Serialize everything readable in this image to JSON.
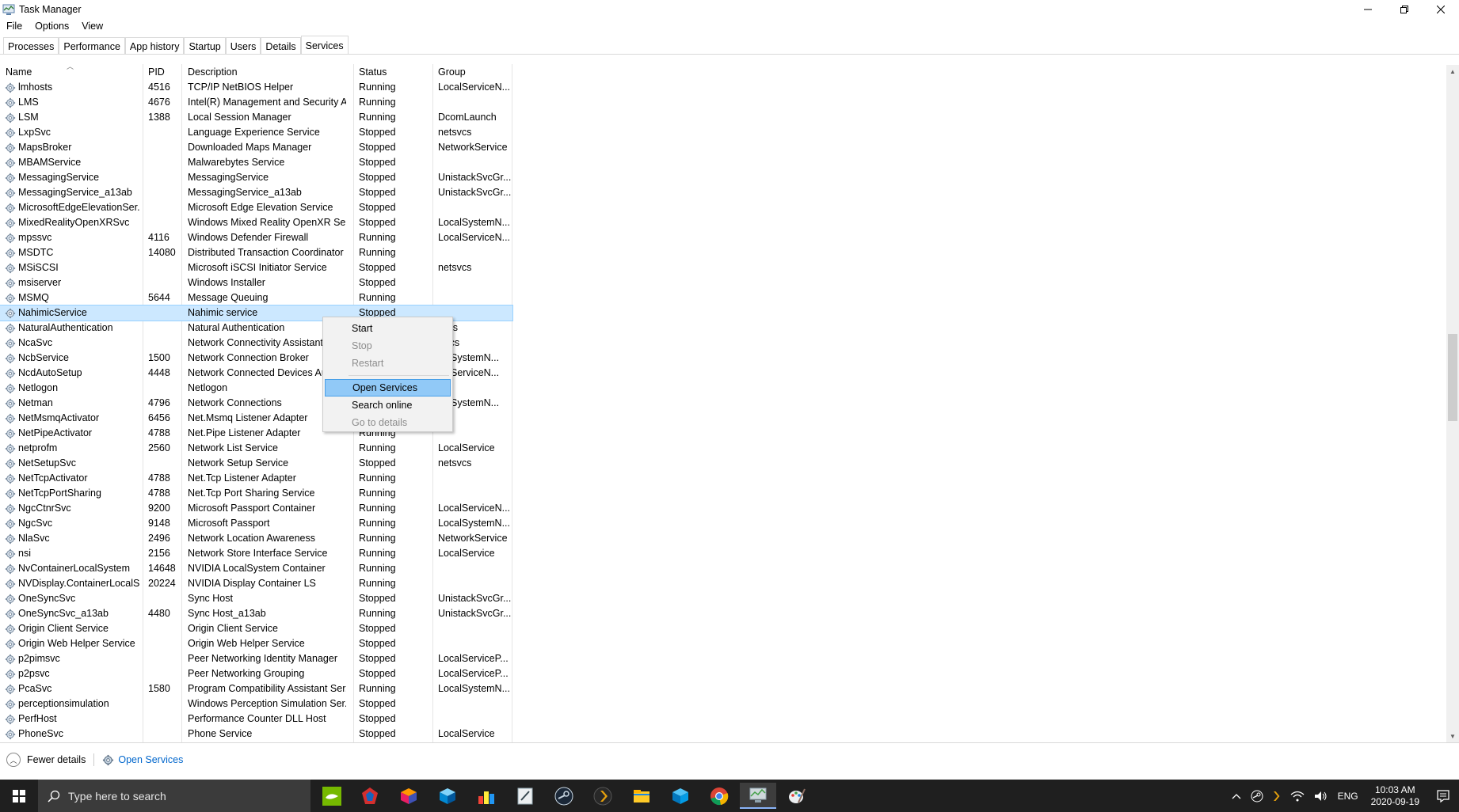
{
  "window": {
    "title": "Task Manager",
    "controls": {
      "minimize": "—",
      "restore": "❐",
      "close": "✕"
    }
  },
  "menu": [
    "File",
    "Options",
    "View"
  ],
  "tabs": [
    {
      "label": "Processes",
      "active": false
    },
    {
      "label": "Performance",
      "active": false
    },
    {
      "label": "App history",
      "active": false
    },
    {
      "label": "Startup",
      "active": false
    },
    {
      "label": "Users",
      "active": false
    },
    {
      "label": "Details",
      "active": false
    },
    {
      "label": "Services",
      "active": true
    }
  ],
  "columns": {
    "name": "Name",
    "pid": "PID",
    "description": "Description",
    "status": "Status",
    "group": "Group"
  },
  "rows": [
    {
      "name": "lmhosts",
      "pid": "4516",
      "desc": "TCP/IP NetBIOS Helper",
      "status": "Running",
      "group": "LocalServiceN..."
    },
    {
      "name": "LMS",
      "pid": "4676",
      "desc": "Intel(R) Management and Security A...",
      "status": "Running",
      "group": ""
    },
    {
      "name": "LSM",
      "pid": "1388",
      "desc": "Local Session Manager",
      "status": "Running",
      "group": "DcomLaunch"
    },
    {
      "name": "LxpSvc",
      "pid": "",
      "desc": "Language Experience Service",
      "status": "Stopped",
      "group": "netsvcs"
    },
    {
      "name": "MapsBroker",
      "pid": "",
      "desc": "Downloaded Maps Manager",
      "status": "Stopped",
      "group": "NetworkService"
    },
    {
      "name": "MBAMService",
      "pid": "",
      "desc": "Malwarebytes Service",
      "status": "Stopped",
      "group": ""
    },
    {
      "name": "MessagingService",
      "pid": "",
      "desc": "MessagingService",
      "status": "Stopped",
      "group": "UnistackSvcGr..."
    },
    {
      "name": "MessagingService_a13ab",
      "pid": "",
      "desc": "MessagingService_a13ab",
      "status": "Stopped",
      "group": "UnistackSvcGr..."
    },
    {
      "name": "MicrosoftEdgeElevationSer...",
      "pid": "",
      "desc": "Microsoft Edge Elevation Service",
      "status": "Stopped",
      "group": ""
    },
    {
      "name": "MixedRealityOpenXRSvc",
      "pid": "",
      "desc": "Windows Mixed Reality OpenXR Ser...",
      "status": "Stopped",
      "group": "LocalSystemN..."
    },
    {
      "name": "mpssvc",
      "pid": "4116",
      "desc": "Windows Defender Firewall",
      "status": "Running",
      "group": "LocalServiceN..."
    },
    {
      "name": "MSDTC",
      "pid": "14080",
      "desc": "Distributed Transaction Coordinator",
      "status": "Running",
      "group": ""
    },
    {
      "name": "MSiSCSI",
      "pid": "",
      "desc": "Microsoft iSCSI Initiator Service",
      "status": "Stopped",
      "group": "netsvcs"
    },
    {
      "name": "msiserver",
      "pid": "",
      "desc": "Windows Installer",
      "status": "Stopped",
      "group": ""
    },
    {
      "name": "MSMQ",
      "pid": "5644",
      "desc": "Message Queuing",
      "status": "Running",
      "group": ""
    },
    {
      "name": "NahimicService",
      "pid": "",
      "desc": "Nahimic service",
      "status": "Stopped",
      "group": "",
      "selected": true
    },
    {
      "name": "NaturalAuthentication",
      "pid": "",
      "desc": "Natural Authentication",
      "status": "",
      "group": "svcs"
    },
    {
      "name": "NcaSvc",
      "pid": "",
      "desc": "Network Connectivity Assistant",
      "status": "",
      "group": "Svcs"
    },
    {
      "name": "NcbService",
      "pid": "1500",
      "desc": "Network Connection Broker",
      "status": "",
      "group": "calSystemN..."
    },
    {
      "name": "NcdAutoSetup",
      "pid": "4448",
      "desc": "Network Connected Devices Aut",
      "status": "",
      "group": "calServiceN..."
    },
    {
      "name": "Netlogon",
      "pid": "",
      "desc": "Netlogon",
      "status": "",
      "group": ""
    },
    {
      "name": "Netman",
      "pid": "4796",
      "desc": "Network Connections",
      "status": "",
      "group": "calSystemN..."
    },
    {
      "name": "NetMsmqActivator",
      "pid": "6456",
      "desc": "Net.Msmq Listener Adapter",
      "status": "",
      "group": ""
    },
    {
      "name": "NetPipeActivator",
      "pid": "4788",
      "desc": "Net.Pipe Listener Adapter",
      "status": "Running",
      "group": ""
    },
    {
      "name": "netprofm",
      "pid": "2560",
      "desc": "Network List Service",
      "status": "Running",
      "group": "LocalService"
    },
    {
      "name": "NetSetupSvc",
      "pid": "",
      "desc": "Network Setup Service",
      "status": "Stopped",
      "group": "netsvcs"
    },
    {
      "name": "NetTcpActivator",
      "pid": "4788",
      "desc": "Net.Tcp Listener Adapter",
      "status": "Running",
      "group": ""
    },
    {
      "name": "NetTcpPortSharing",
      "pid": "4788",
      "desc": "Net.Tcp Port Sharing Service",
      "status": "Running",
      "group": ""
    },
    {
      "name": "NgcCtnrSvc",
      "pid": "9200",
      "desc": "Microsoft Passport Container",
      "status": "Running",
      "group": "LocalServiceN..."
    },
    {
      "name": "NgcSvc",
      "pid": "9148",
      "desc": "Microsoft Passport",
      "status": "Running",
      "group": "LocalSystemN..."
    },
    {
      "name": "NlaSvc",
      "pid": "2496",
      "desc": "Network Location Awareness",
      "status": "Running",
      "group": "NetworkService"
    },
    {
      "name": "nsi",
      "pid": "2156",
      "desc": "Network Store Interface Service",
      "status": "Running",
      "group": "LocalService"
    },
    {
      "name": "NvContainerLocalSystem",
      "pid": "14648",
      "desc": "NVIDIA LocalSystem Container",
      "status": "Running",
      "group": ""
    },
    {
      "name": "NVDisplay.ContainerLocalS...",
      "pid": "20224",
      "desc": "NVIDIA Display Container LS",
      "status": "Running",
      "group": ""
    },
    {
      "name": "OneSyncSvc",
      "pid": "",
      "desc": "Sync Host",
      "status": "Stopped",
      "group": "UnistackSvcGr..."
    },
    {
      "name": "OneSyncSvc_a13ab",
      "pid": "4480",
      "desc": "Sync Host_a13ab",
      "status": "Running",
      "group": "UnistackSvcGr..."
    },
    {
      "name": "Origin Client Service",
      "pid": "",
      "desc": "Origin Client Service",
      "status": "Stopped",
      "group": ""
    },
    {
      "name": "Origin Web Helper Service",
      "pid": "",
      "desc": "Origin Web Helper Service",
      "status": "Stopped",
      "group": ""
    },
    {
      "name": "p2pimsvc",
      "pid": "",
      "desc": "Peer Networking Identity Manager",
      "status": "Stopped",
      "group": "LocalServiceP..."
    },
    {
      "name": "p2psvc",
      "pid": "",
      "desc": "Peer Networking Grouping",
      "status": "Stopped",
      "group": "LocalServiceP..."
    },
    {
      "name": "PcaSvc",
      "pid": "1580",
      "desc": "Program Compatibility Assistant Ser...",
      "status": "Running",
      "group": "LocalSystemN..."
    },
    {
      "name": "perceptionsimulation",
      "pid": "",
      "desc": "Windows Perception Simulation Ser...",
      "status": "Stopped",
      "group": ""
    },
    {
      "name": "PerfHost",
      "pid": "",
      "desc": "Performance Counter DLL Host",
      "status": "Stopped",
      "group": ""
    },
    {
      "name": "PhoneSvc",
      "pid": "",
      "desc": "Phone Service",
      "status": "Stopped",
      "group": "LocalService"
    }
  ],
  "context_menu": {
    "items": [
      {
        "label": "Start",
        "enabled": true,
        "highlight": false
      },
      {
        "label": "Stop",
        "enabled": false,
        "highlight": false
      },
      {
        "label": "Restart",
        "enabled": false,
        "highlight": false
      },
      {
        "label": "Open Services",
        "enabled": true,
        "highlight": true
      },
      {
        "label": "Search online",
        "enabled": true,
        "highlight": false
      },
      {
        "label": "Go to details",
        "enabled": false,
        "highlight": false
      }
    ]
  },
  "footer": {
    "fewer_details": "Fewer details",
    "open_services": "Open Services"
  },
  "taskbar": {
    "search_placeholder": "Type here to search",
    "apps": [
      "nvidia-icon",
      "red-app-icon",
      "colorful-cube-icon",
      "blue-box-icon",
      "red-yellow-app-icon",
      "editor-icon",
      "steam-icon",
      "plex-icon",
      "file-explorer-icon",
      "blue-box-2-icon",
      "chrome-icon",
      "task-manager-icon",
      "paint-icon"
    ],
    "language": "ENG",
    "time": "10:03 AM",
    "date": "2020-09-19"
  },
  "colors": {
    "selection": "#cce8ff",
    "menu_highlight": "#91c9f7",
    "link": "#0066cc",
    "taskbar": "#1f1f1f"
  }
}
